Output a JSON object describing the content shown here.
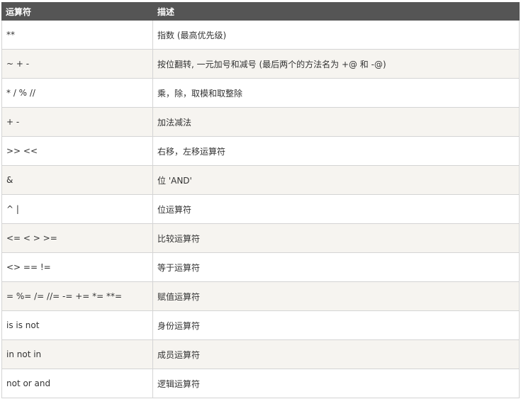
{
  "table": {
    "headers": [
      "运算符",
      "描述"
    ],
    "rows": [
      {
        "operator": "**",
        "description": "指数 (最高优先级)"
      },
      {
        "operator": "~ + -",
        "description": "按位翻转, 一元加号和减号 (最后两个的方法名为 +@ 和 -@)"
      },
      {
        "operator": "* / % //",
        "description": "乘，除，取模和取整除"
      },
      {
        "operator": "+ -",
        "description": "加法减法"
      },
      {
        "operator": ">> <<",
        "description": "右移，左移运算符"
      },
      {
        "operator": "&",
        "description": "位 'AND'"
      },
      {
        "operator": "^ |",
        "description": "位运算符"
      },
      {
        "operator": "<= < > >=",
        "description": "比较运算符"
      },
      {
        "operator": "<> == !=",
        "description": "等于运算符"
      },
      {
        "operator": "= %= /= //= -= += *= **=",
        "description": "赋值运算符"
      },
      {
        "operator": "is is not",
        "description": "身份运算符"
      },
      {
        "operator": "in not in",
        "description": "成员运算符"
      },
      {
        "operator": "not or and",
        "description": "逻辑运算符"
      }
    ]
  },
  "colors": {
    "header_bg": "#555555",
    "header_text": "#ffffff",
    "row_alt_bg": "#f6f4f0",
    "border": "#d4d4d4",
    "cell_text": "#333333"
  }
}
